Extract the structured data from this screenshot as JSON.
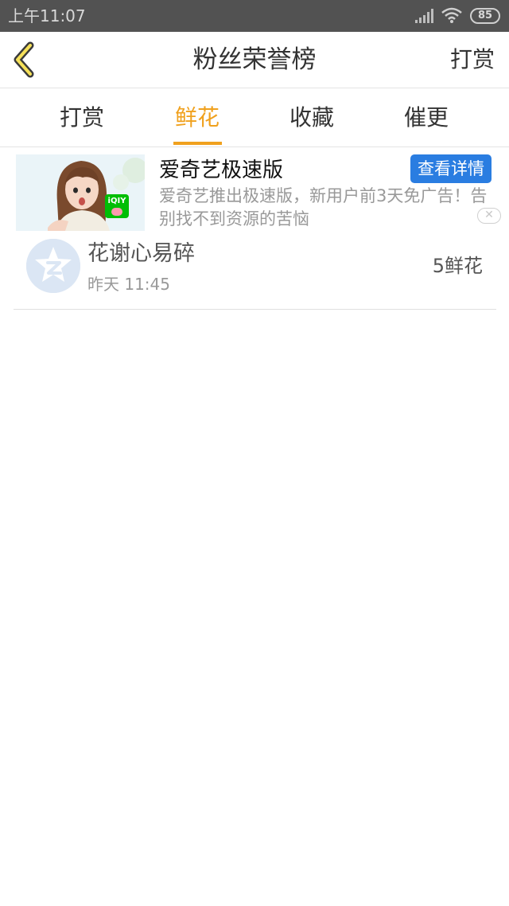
{
  "status_bar": {
    "time": "上午11:07",
    "battery": "85",
    "signal_icon": "cell-signal-icon",
    "wifi_icon": "wifi-icon"
  },
  "header": {
    "back_icon": "chevron-left-icon",
    "title": "粉丝荣誉榜",
    "action_label": "打赏"
  },
  "tabs": [
    {
      "label": "打赏",
      "active": false
    },
    {
      "label": "鲜花",
      "active": true
    },
    {
      "label": "收藏",
      "active": false
    },
    {
      "label": "催更",
      "active": false
    }
  ],
  "colors": {
    "accent": "#f0a11e",
    "status_bar": "#525252",
    "ad_button": "#2a7de1"
  },
  "ad": {
    "title": "爱奇艺极速版",
    "description": "爱奇艺推出极速版，新用户前3天免广告！告别找不到资源的苦恼",
    "button_label": "查看详情",
    "close_icon": "close-icon",
    "image_badge": "iQIY"
  },
  "list": [
    {
      "name": "花谢心易碎",
      "time": "昨天 11:45",
      "amount": "5鲜花",
      "avatar_icon": "default-avatar-icon"
    }
  ]
}
